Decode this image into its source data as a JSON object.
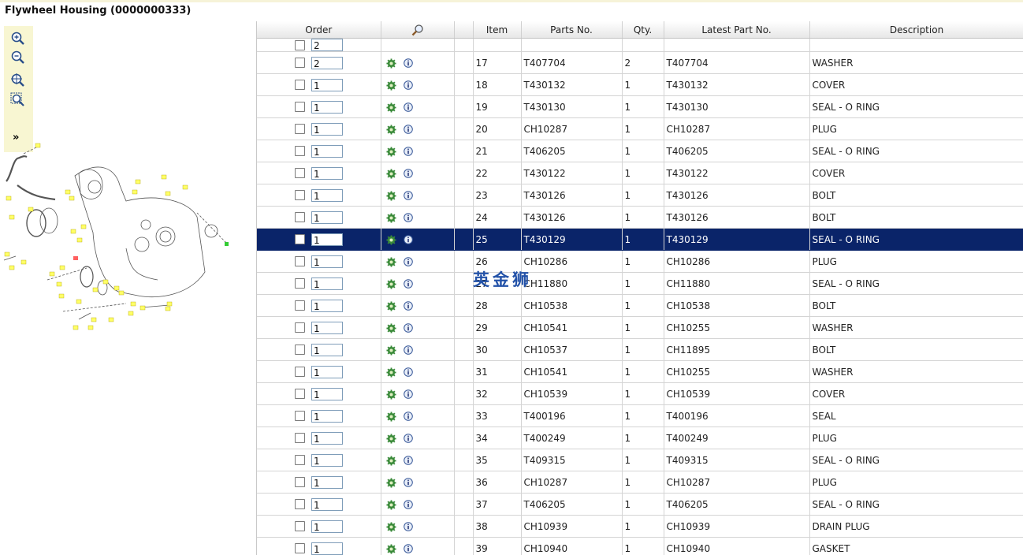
{
  "title": "Flywheel Housing (0000000333)",
  "toolbar": {
    "zoom_in": "zoom-in-icon",
    "zoom_out": "zoom-out-icon",
    "zoom_extents": "zoom-extents-icon",
    "zoom_window": "zoom-window-icon",
    "expand_label": "»"
  },
  "columns": {
    "order": "Order",
    "search_icon": "magnifier-icon",
    "item": "Item",
    "parts_no": "Parts No.",
    "qty": "Qty.",
    "latest": "Latest Part No.",
    "description": "Description"
  },
  "partial_row": {
    "qty": "2"
  },
  "rows": [
    {
      "qty": "2",
      "item": "17",
      "part": "T407704",
      "q": "2",
      "latest": "T407704",
      "desc": "WASHER"
    },
    {
      "qty": "1",
      "item": "18",
      "part": "T430132",
      "q": "1",
      "latest": "T430132",
      "desc": "COVER"
    },
    {
      "qty": "1",
      "item": "19",
      "part": "T430130",
      "q": "1",
      "latest": "T430130",
      "desc": "SEAL - O RING"
    },
    {
      "qty": "1",
      "item": "20",
      "part": "CH10287",
      "q": "1",
      "latest": "CH10287",
      "desc": "PLUG"
    },
    {
      "qty": "1",
      "item": "21",
      "part": "T406205",
      "q": "1",
      "latest": "T406205",
      "desc": "SEAL - O RING"
    },
    {
      "qty": "1",
      "item": "22",
      "part": "T430122",
      "q": "1",
      "latest": "T430122",
      "desc": "COVER"
    },
    {
      "qty": "1",
      "item": "23",
      "part": "T430126",
      "q": "1",
      "latest": "T430126",
      "desc": "BOLT"
    },
    {
      "qty": "1",
      "item": "24",
      "part": "T430126",
      "q": "1",
      "latest": "T430126",
      "desc": "BOLT"
    },
    {
      "qty": "1",
      "item": "25",
      "part": "T430129",
      "q": "1",
      "latest": "T430129",
      "desc": "SEAL - O RING"
    },
    {
      "qty": "1",
      "item": "26",
      "part": "CH10286",
      "q": "1",
      "latest": "CH10286",
      "desc": "PLUG"
    },
    {
      "qty": "1",
      "item": "27",
      "part": "CH11880",
      "q": "1",
      "latest": "CH11880",
      "desc": "SEAL - O RING"
    },
    {
      "qty": "1",
      "item": "28",
      "part": "CH10538",
      "q": "1",
      "latest": "CH10538",
      "desc": "BOLT"
    },
    {
      "qty": "1",
      "item": "29",
      "part": "CH10541",
      "q": "1",
      "latest": "CH10255",
      "desc": "WASHER"
    },
    {
      "qty": "1",
      "item": "30",
      "part": "CH10537",
      "q": "1",
      "latest": "CH11895",
      "desc": "BOLT"
    },
    {
      "qty": "1",
      "item": "31",
      "part": "CH10541",
      "q": "1",
      "latest": "CH10255",
      "desc": "WASHER"
    },
    {
      "qty": "1",
      "item": "32",
      "part": "CH10539",
      "q": "1",
      "latest": "CH10539",
      "desc": "COVER"
    },
    {
      "qty": "1",
      "item": "33",
      "part": "T400196",
      "q": "1",
      "latest": "T400196",
      "desc": "SEAL"
    },
    {
      "qty": "1",
      "item": "34",
      "part": "T400249",
      "q": "1",
      "latest": "T400249",
      "desc": "PLUG"
    },
    {
      "qty": "1",
      "item": "35",
      "part": "T409315",
      "q": "1",
      "latest": "T409315",
      "desc": "SEAL - O RING"
    },
    {
      "qty": "1",
      "item": "36",
      "part": "CH10287",
      "q": "1",
      "latest": "CH10287",
      "desc": "PLUG"
    },
    {
      "qty": "1",
      "item": "37",
      "part": "T406205",
      "q": "1",
      "latest": "T406205",
      "desc": "SEAL - O RING"
    },
    {
      "qty": "1",
      "item": "38",
      "part": "CH10939",
      "q": "1",
      "latest": "CH10939",
      "desc": "DRAIN PLUG"
    },
    {
      "qty": "1",
      "item": "39",
      "part": "CH10940",
      "q": "1",
      "latest": "CH10940",
      "desc": "GASKET"
    }
  ],
  "selected_item": "25",
  "watermark": "英金狮",
  "colors": {
    "selected_row": "#0a2469",
    "toolbar_bg": "#f8f6d2",
    "callout": "#ffff66"
  }
}
